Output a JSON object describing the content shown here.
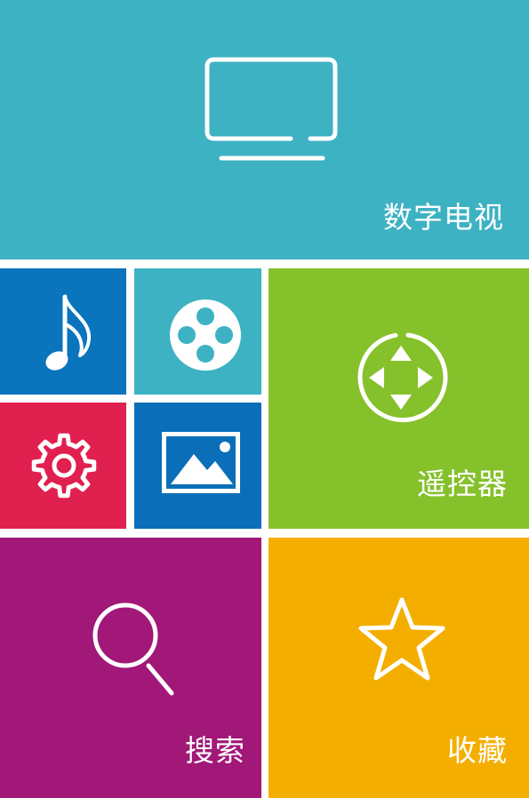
{
  "colors": {
    "tv": "#3db2c2",
    "music": "#0a74bd",
    "video": "#3db2c2",
    "settings": "#e0204f",
    "photo": "#0a6fb8",
    "remote": "#85c12b",
    "search": "#a11878",
    "favorites": "#f4ae00",
    "icon": "#ffffff"
  },
  "tiles": {
    "tv": {
      "label": "数字电视",
      "icon": "tv-icon"
    },
    "music": {
      "icon": "music-note-icon"
    },
    "video": {
      "icon": "film-reel-icon"
    },
    "settings": {
      "icon": "gear-icon"
    },
    "photo": {
      "icon": "picture-icon"
    },
    "remote": {
      "label": "遥控器",
      "icon": "dpad-icon"
    },
    "search": {
      "label": "搜索",
      "icon": "search-icon"
    },
    "favorites": {
      "label": "收藏",
      "icon": "star-icon"
    }
  }
}
